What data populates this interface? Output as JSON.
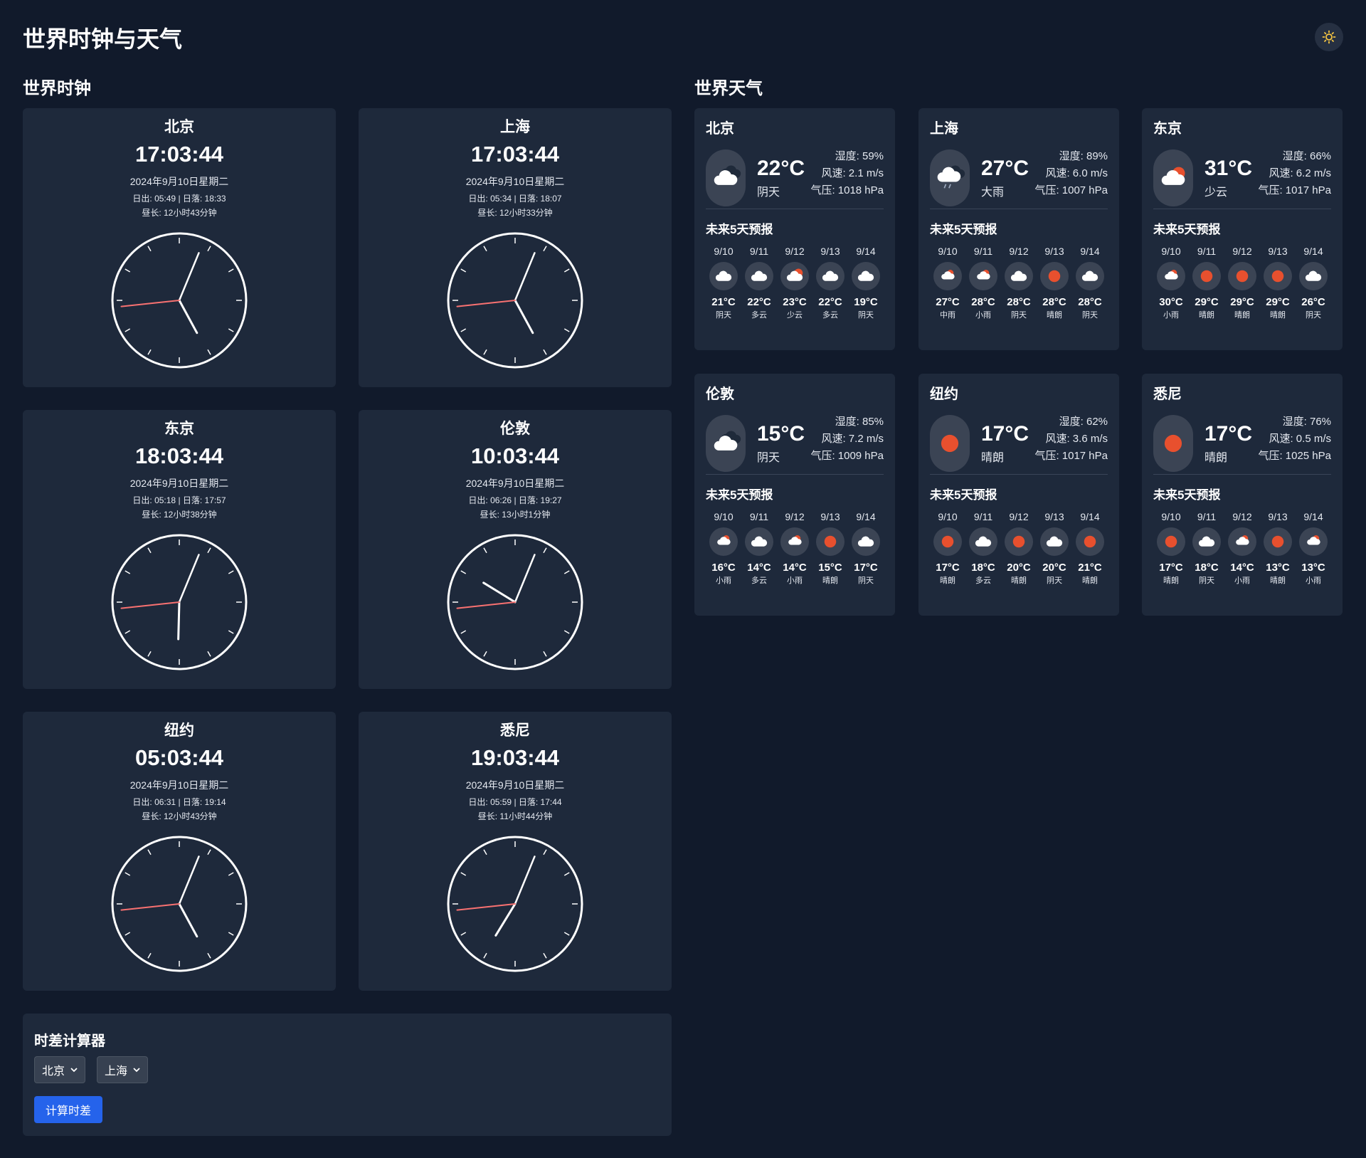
{
  "app": {
    "title": "世界时钟与天气"
  },
  "sections": {
    "clocks_title": "世界时钟",
    "weather_title": "世界天气"
  },
  "clocks": [
    {
      "city": "北京",
      "time": "17:03:44",
      "date": "2024年9月10日星期二",
      "sun": "日出: 05:49 | 日落: 18:33",
      "daylength": "昼长: 12小时43分钟"
    },
    {
      "city": "上海",
      "time": "17:03:44",
      "date": "2024年9月10日星期二",
      "sun": "日出: 05:34 | 日落: 18:07",
      "daylength": "昼长: 12小时33分钟"
    },
    {
      "city": "东京",
      "time": "18:03:44",
      "date": "2024年9月10日星期二",
      "sun": "日出: 05:18 | 日落: 17:57",
      "daylength": "昼长: 12小时38分钟"
    },
    {
      "city": "伦敦",
      "time": "10:03:44",
      "date": "2024年9月10日星期二",
      "sun": "日出: 06:26 | 日落: 19:27",
      "daylength": "昼长: 13小时1分钟"
    },
    {
      "city": "纽约",
      "time": "05:03:44",
      "date": "2024年9月10日星期二",
      "sun": "日出: 06:31 | 日落: 19:14",
      "daylength": "昼长: 12小时43分钟"
    },
    {
      "city": "悉尼",
      "time": "19:03:44",
      "date": "2024年9月10日星期二",
      "sun": "日出: 05:59 | 日落: 17:44",
      "daylength": "昼长: 11小时44分钟"
    }
  ],
  "weather": [
    {
      "city": "北京",
      "temp": "22°C",
      "desc": "阴天",
      "icon": "cloud-sun-icon",
      "humidity": "湿度: 59%",
      "wind": "风速: 2.1 m/s",
      "pressure": "气压: 1018 hPa",
      "forecast_title": "未来5天预报",
      "forecast": [
        {
          "date": "9/10",
          "icon": "cloud-icon",
          "temp": "21°C",
          "desc": "阴天"
        },
        {
          "date": "9/11",
          "icon": "cloud-icon",
          "temp": "22°C",
          "desc": "多云"
        },
        {
          "date": "9/12",
          "icon": "partly-cloudy-icon",
          "temp": "23°C",
          "desc": "少云"
        },
        {
          "date": "9/13",
          "icon": "cloud-icon",
          "temp": "22°C",
          "desc": "多云"
        },
        {
          "date": "9/14",
          "icon": "cloud-icon",
          "temp": "19°C",
          "desc": "阴天"
        }
      ]
    },
    {
      "city": "上海",
      "temp": "27°C",
      "desc": "大雨",
      "icon": "rain-cloud-icon",
      "humidity": "湿度: 89%",
      "wind": "风速: 6.0 m/s",
      "pressure": "气压: 1007 hPa",
      "forecast_title": "未来5天预报",
      "forecast": [
        {
          "date": "9/10",
          "icon": "sun-rain-icon",
          "temp": "27°C",
          "desc": "中雨"
        },
        {
          "date": "9/11",
          "icon": "sun-rain-icon",
          "temp": "28°C",
          "desc": "小雨"
        },
        {
          "date": "9/12",
          "icon": "cloud-icon",
          "temp": "28°C",
          "desc": "阴天"
        },
        {
          "date": "9/13",
          "icon": "sun-icon",
          "temp": "28°C",
          "desc": "晴朗"
        },
        {
          "date": "9/14",
          "icon": "cloud-icon",
          "temp": "28°C",
          "desc": "阴天"
        }
      ]
    },
    {
      "city": "东京",
      "temp": "31°C",
      "desc": "少云",
      "icon": "partly-cloudy-icon",
      "humidity": "湿度: 66%",
      "wind": "风速: 6.2 m/s",
      "pressure": "气压: 1017 hPa",
      "forecast_title": "未来5天预报",
      "forecast": [
        {
          "date": "9/10",
          "icon": "sun-rain-icon",
          "temp": "30°C",
          "desc": "小雨"
        },
        {
          "date": "9/11",
          "icon": "sun-icon",
          "temp": "29°C",
          "desc": "晴朗"
        },
        {
          "date": "9/12",
          "icon": "sun-icon",
          "temp": "29°C",
          "desc": "晴朗"
        },
        {
          "date": "9/13",
          "icon": "sun-icon",
          "temp": "29°C",
          "desc": "晴朗"
        },
        {
          "date": "9/14",
          "icon": "cloud-icon",
          "temp": "26°C",
          "desc": "阴天"
        }
      ]
    },
    {
      "city": "伦敦",
      "temp": "15°C",
      "desc": "阴天",
      "icon": "cloud-sun-icon",
      "humidity": "湿度: 85%",
      "wind": "风速: 7.2 m/s",
      "pressure": "气压: 1009 hPa",
      "forecast_title": "未来5天预报",
      "forecast": [
        {
          "date": "9/10",
          "icon": "sun-rain-icon",
          "temp": "16°C",
          "desc": "小雨"
        },
        {
          "date": "9/11",
          "icon": "cloud-icon",
          "temp": "14°C",
          "desc": "多云"
        },
        {
          "date": "9/12",
          "icon": "sun-rain-icon",
          "temp": "14°C",
          "desc": "小雨"
        },
        {
          "date": "9/13",
          "icon": "sun-icon",
          "temp": "15°C",
          "desc": "晴朗"
        },
        {
          "date": "9/14",
          "icon": "cloud-icon",
          "temp": "17°C",
          "desc": "阴天"
        }
      ]
    },
    {
      "city": "纽约",
      "temp": "17°C",
      "desc": "晴朗",
      "icon": "sun-icon",
      "humidity": "湿度: 62%",
      "wind": "风速: 3.6 m/s",
      "pressure": "气压: 1017 hPa",
      "forecast_title": "未来5天预报",
      "forecast": [
        {
          "date": "9/10",
          "icon": "sun-icon",
          "temp": "17°C",
          "desc": "晴朗"
        },
        {
          "date": "9/11",
          "icon": "cloud-icon",
          "temp": "18°C",
          "desc": "多云"
        },
        {
          "date": "9/12",
          "icon": "sun-icon",
          "temp": "20°C",
          "desc": "晴朗"
        },
        {
          "date": "9/13",
          "icon": "cloud-icon",
          "temp": "20°C",
          "desc": "阴天"
        },
        {
          "date": "9/14",
          "icon": "sun-icon",
          "temp": "21°C",
          "desc": "晴朗"
        }
      ]
    },
    {
      "city": "悉尼",
      "temp": "17°C",
      "desc": "晴朗",
      "icon": "sun-icon",
      "humidity": "湿度: 76%",
      "wind": "风速: 0.5 m/s",
      "pressure": "气压: 1025 hPa",
      "forecast_title": "未来5天预报",
      "forecast": [
        {
          "date": "9/10",
          "icon": "sun-icon",
          "temp": "17°C",
          "desc": "晴朗"
        },
        {
          "date": "9/11",
          "icon": "cloud-icon",
          "temp": "18°C",
          "desc": "阴天"
        },
        {
          "date": "9/12",
          "icon": "sun-rain-icon",
          "temp": "14°C",
          "desc": "小雨"
        },
        {
          "date": "9/13",
          "icon": "sun-icon",
          "temp": "13°C",
          "desc": "晴朗"
        },
        {
          "date": "9/14",
          "icon": "sun-rain-icon",
          "temp": "13°C",
          "desc": "小雨"
        }
      ]
    }
  ],
  "calculator": {
    "title": "时差计算器",
    "from_value": "北京",
    "to_value": "上海",
    "button_label": "计算时差"
  },
  "colors": {
    "background": "#111a2b",
    "card": "#1e293b",
    "accent": "#2563eb",
    "sun": "#e8502e",
    "second_hand": "#f87171"
  }
}
